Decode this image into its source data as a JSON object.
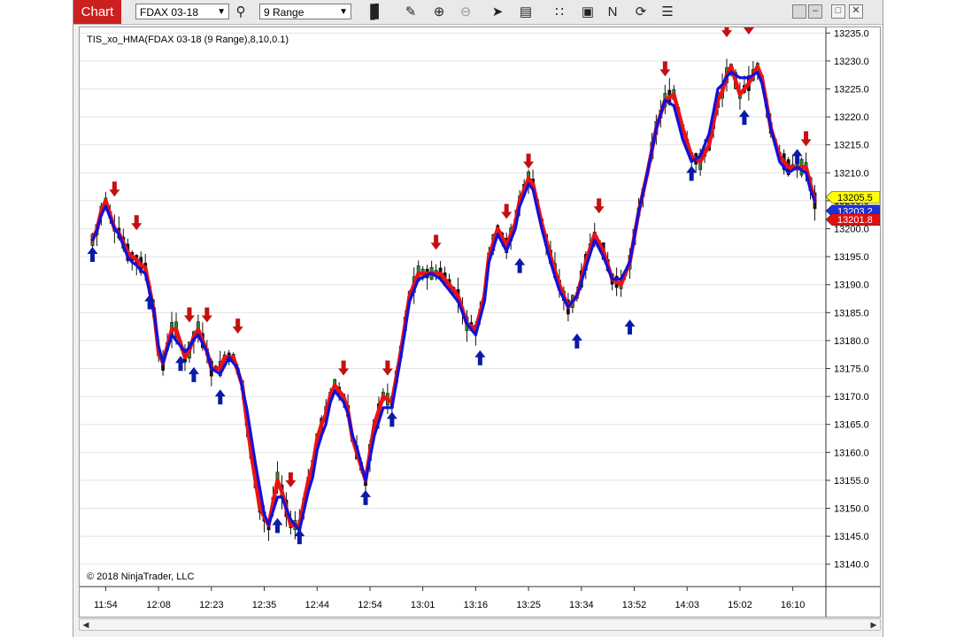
{
  "toolbar": {
    "chart_label": "Chart",
    "instrument": "FDAX 03-18",
    "interval": "9 Range",
    "icons": [
      "search-icon",
      "bar-type-icon",
      "pencil-icon",
      "zoom-in-icon",
      "zoom-out-icon",
      "pointer-icon",
      "data-box-icon",
      "chart-trader-icon",
      "strategies-icon",
      "indicators-icon",
      "reload-icon",
      "properties-icon"
    ]
  },
  "window_buttons": [
    "restore-icon",
    "minimize-icon",
    "maximize-icon",
    "close-icon"
  ],
  "chart_data": {
    "type": "candlestick",
    "indicator_label": "TIS_xo_HMA(FDAX 03-18 (9 Range),8,10,0.1)",
    "copyright": "© 2018 NinjaTrader, LLC",
    "ylim": [
      13136,
      13236
    ],
    "y_ticks": [
      "13235.0",
      "13230.0",
      "13225.0",
      "13220.0",
      "13215.0",
      "13210.0",
      "13205.0",
      "13200.0",
      "13195.0",
      "13190.0",
      "13185.0",
      "13180.0",
      "13175.0",
      "13170.0",
      "13165.0",
      "13160.0",
      "13155.0",
      "13150.0",
      "13145.0",
      "13140.0"
    ],
    "x_ticks": [
      "11:54",
      "12:08",
      "12:23",
      "12:35",
      "12:44",
      "12:54",
      "13:01",
      "13:16",
      "13:25",
      "13:34",
      "13:52",
      "14:03",
      "15:02",
      "16:10"
    ],
    "x_tick_bar_index": [
      3,
      15,
      27,
      39,
      51,
      63,
      75,
      87,
      99,
      111,
      123,
      135,
      147,
      159
    ],
    "bar_count": 165,
    "series": [
      {
        "name": "HMA fast",
        "color": "#ee1111",
        "anchors": [
          [
            0,
            13198
          ],
          [
            3,
            13205
          ],
          [
            5,
            13200
          ],
          [
            9,
            13195
          ],
          [
            12,
            13193
          ],
          [
            14,
            13185
          ],
          [
            15,
            13178
          ],
          [
            16,
            13176
          ],
          [
            18,
            13182
          ],
          [
            19,
            13182
          ],
          [
            21,
            13177
          ],
          [
            24,
            13182
          ],
          [
            26,
            13178
          ],
          [
            27,
            13175
          ],
          [
            29,
            13175
          ],
          [
            30,
            13177
          ],
          [
            32,
            13177
          ],
          [
            34,
            13172
          ],
          [
            36,
            13160
          ],
          [
            38,
            13150
          ],
          [
            40,
            13147
          ],
          [
            42,
            13155
          ],
          [
            43,
            13153
          ],
          [
            45,
            13147
          ],
          [
            47,
            13147
          ],
          [
            49,
            13155
          ],
          [
            52,
            13165
          ],
          [
            55,
            13172
          ],
          [
            57,
            13170
          ],
          [
            60,
            13160
          ],
          [
            62,
            13155
          ],
          [
            64,
            13165
          ],
          [
            66,
            13170
          ],
          [
            68,
            13169
          ],
          [
            70,
            13178
          ],
          [
            72,
            13188
          ],
          [
            74,
            13192
          ],
          [
            77,
            13192
          ],
          [
            79,
            13192
          ],
          [
            81,
            13190
          ],
          [
            83,
            13188
          ],
          [
            85,
            13183
          ],
          [
            87,
            13182
          ],
          [
            89,
            13188
          ],
          [
            90,
            13195
          ],
          [
            92,
            13200
          ],
          [
            94,
            13197
          ],
          [
            96,
            13201
          ],
          [
            97,
            13205
          ],
          [
            99,
            13209
          ],
          [
            100,
            13208
          ],
          [
            102,
            13201
          ],
          [
            104,
            13195
          ],
          [
            106,
            13190
          ],
          [
            108,
            13186
          ],
          [
            110,
            13188
          ],
          [
            112,
            13194
          ],
          [
            114,
            13199
          ],
          [
            116,
            13196
          ],
          [
            118,
            13191
          ],
          [
            120,
            13190
          ],
          [
            122,
            13194
          ],
          [
            124,
            13203
          ],
          [
            126,
            13210
          ],
          [
            128,
            13218
          ],
          [
            130,
            13223
          ],
          [
            132,
            13224
          ],
          [
            134,
            13218
          ],
          [
            136,
            13213
          ],
          [
            138,
            13212
          ],
          [
            140,
            13215
          ],
          [
            142,
            13223
          ],
          [
            145,
            13229
          ],
          [
            147,
            13224
          ],
          [
            149,
            13226
          ],
          [
            151,
            13229
          ],
          [
            152,
            13227
          ],
          [
            154,
            13218
          ],
          [
            156,
            13213
          ],
          [
            158,
            13211
          ],
          [
            160,
            13211
          ],
          [
            162,
            13211
          ],
          [
            163,
            13208
          ],
          [
            165,
            13202
          ]
        ]
      },
      {
        "name": "HMA slow",
        "color": "#1010dd",
        "anchors": [
          [
            0,
            13198
          ],
          [
            3,
            13204
          ],
          [
            5,
            13200
          ],
          [
            9,
            13194
          ],
          [
            12,
            13192
          ],
          [
            14,
            13185
          ],
          [
            15,
            13179
          ],
          [
            16,
            13176
          ],
          [
            18,
            13181
          ],
          [
            19,
            13180
          ],
          [
            21,
            13178
          ],
          [
            24,
            13181
          ],
          [
            26,
            13178
          ],
          [
            27,
            13175
          ],
          [
            29,
            13174
          ],
          [
            31,
            13177
          ],
          [
            33,
            13175
          ],
          [
            35,
            13168
          ],
          [
            37,
            13158
          ],
          [
            39,
            13149
          ],
          [
            40,
            13147
          ],
          [
            42,
            13152
          ],
          [
            43,
            13152
          ],
          [
            45,
            13148
          ],
          [
            47,
            13146
          ],
          [
            49,
            13153
          ],
          [
            52,
            13163
          ],
          [
            55,
            13171
          ],
          [
            57,
            13169
          ],
          [
            60,
            13161
          ],
          [
            62,
            13155
          ],
          [
            64,
            13163
          ],
          [
            66,
            13168
          ],
          [
            68,
            13168
          ],
          [
            70,
            13177
          ],
          [
            72,
            13187
          ],
          [
            74,
            13191
          ],
          [
            77,
            13192
          ],
          [
            79,
            13191
          ],
          [
            81,
            13189
          ],
          [
            83,
            13187
          ],
          [
            85,
            13183
          ],
          [
            87,
            13181
          ],
          [
            89,
            13187
          ],
          [
            90,
            13194
          ],
          [
            92,
            13199
          ],
          [
            94,
            13196
          ],
          [
            96,
            13200
          ],
          [
            97,
            13204
          ],
          [
            99,
            13208
          ],
          [
            100,
            13207
          ],
          [
            102,
            13200
          ],
          [
            104,
            13194
          ],
          [
            106,
            13189
          ],
          [
            108,
            13186
          ],
          [
            110,
            13188
          ],
          [
            112,
            13193
          ],
          [
            114,
            13198
          ],
          [
            116,
            13195
          ],
          [
            118,
            13191
          ],
          [
            120,
            13191
          ],
          [
            122,
            13194
          ],
          [
            124,
            13203
          ],
          [
            126,
            13210
          ],
          [
            128,
            13218
          ],
          [
            130,
            13223
          ],
          [
            132,
            13222
          ],
          [
            134,
            13216
          ],
          [
            136,
            13212
          ],
          [
            138,
            13213
          ],
          [
            140,
            13217
          ],
          [
            142,
            13225
          ],
          [
            145,
            13228
          ],
          [
            147,
            13227
          ],
          [
            149,
            13227
          ],
          [
            151,
            13228
          ],
          [
            152,
            13226
          ],
          [
            154,
            13218
          ],
          [
            156,
            13212
          ],
          [
            158,
            13210
          ],
          [
            160,
            13211
          ],
          [
            162,
            13210
          ],
          [
            163,
            13207
          ],
          [
            165,
            13203
          ]
        ]
      }
    ],
    "up_arrow_bars": [
      [
        0,
        13195.5
      ],
      [
        13,
        13187
      ],
      [
        20,
        13176
      ],
      [
        23,
        13174
      ],
      [
        29,
        13170
      ],
      [
        42,
        13147
      ],
      [
        47,
        13145
      ],
      [
        62,
        13152
      ],
      [
        68,
        13166
      ],
      [
        88,
        13177
      ],
      [
        97,
        13193.5
      ],
      [
        110,
        13180
      ],
      [
        122,
        13182.5
      ],
      [
        136,
        13210
      ],
      [
        148,
        13220
      ],
      [
        160,
        13213
      ]
    ],
    "down_arrow_bars": [
      [
        5,
        13207
      ],
      [
        10,
        13201
      ],
      [
        22,
        13184.5
      ],
      [
        26,
        13184.5
      ],
      [
        33,
        13182.5
      ],
      [
        45,
        13155
      ],
      [
        57,
        13175
      ],
      [
        67,
        13175
      ],
      [
        78,
        13197.5
      ],
      [
        94,
        13203
      ],
      [
        99,
        13212
      ],
      [
        115,
        13204
      ],
      [
        130,
        13228.5
      ],
      [
        144,
        13235.5
      ],
      [
        149,
        13236
      ],
      [
        162,
        13216
      ]
    ],
    "price_labels": [
      {
        "value": "13205.5",
        "price": 13205.5,
        "fill": "#ffff00",
        "text_color": "#000000"
      },
      {
        "value": "13203.2",
        "price": 13203.2,
        "fill": "#1e2fd6",
        "text_color": "#ffffff"
      },
      {
        "value": "13201.8",
        "price": 13201.8,
        "fill": "#dd1111",
        "text_color": "#ffffff"
      }
    ],
    "grid": true,
    "candle_up_color": "#2e8b2e",
    "candle_down_color": "#151515"
  }
}
